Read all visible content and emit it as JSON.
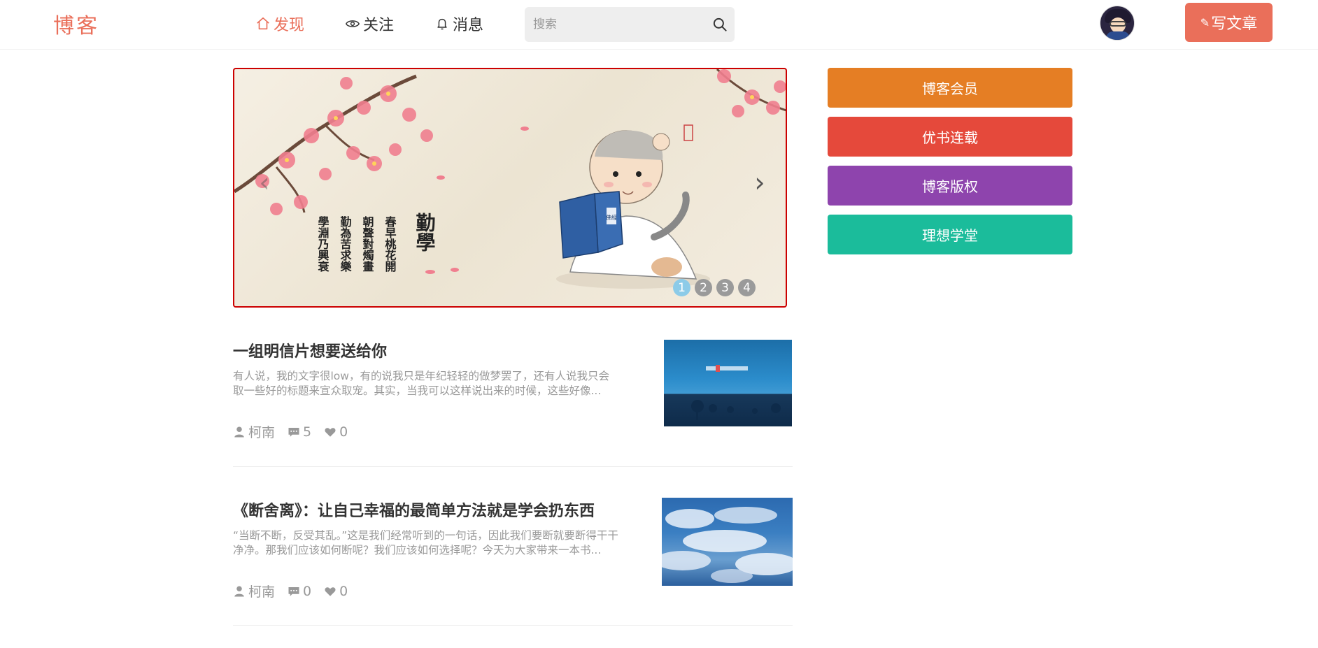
{
  "header": {
    "logo": "博客",
    "nav": [
      {
        "label": "发现",
        "icon": "home-icon",
        "active": true
      },
      {
        "label": "关注",
        "icon": "eye-icon",
        "active": false
      },
      {
        "label": "消息",
        "icon": "bell-icon",
        "active": false
      }
    ],
    "search": {
      "placeholder": "搜索",
      "icon": "search-icon"
    },
    "avatar_icon": "user-avatar",
    "write_button": "写文章"
  },
  "carousel": {
    "poem_title": "勤學",
    "poem_lines": [
      "春早桃花開",
      "朝聲對燭畫",
      "勤為苦求樂",
      "學淵乃興衰"
    ],
    "book_label": "佛經",
    "indicators": [
      "1",
      "2",
      "3",
      "4"
    ],
    "active_index": 0
  },
  "articles": [
    {
      "title": "一组明信片想要送给你",
      "abstract": "有人说，我的文字很low，有的说我只是年纪轻轻的做梦罢了，还有人说我只会取一些好的标题来宣众取宠。其实，当我可以这样说出来的时候，这些好像...",
      "author": "柯南",
      "comments": "5",
      "likes": "0"
    },
    {
      "title": "《断舍离》：让自己幸福的最简单方法就是学会扔东西",
      "abstract": "“当断不断，反受其乱。”这是我们经常听到的一句话，因此我们要断就要断得干干净净。那我们应该如何断呢？我们应该如何选择呢？今天为大家带来一本书...",
      "author": "柯南",
      "comments": "0",
      "likes": "0"
    }
  ],
  "sidebar": {
    "buttons": [
      "博客会员",
      "优书连载",
      "博客版权",
      "理想学堂"
    ]
  },
  "colors": {
    "accent": "#ea6f5a",
    "member": "#e57e24",
    "serial": "#e5493b",
    "copyright": "#8e44ad",
    "school": "#1bbc9b"
  }
}
